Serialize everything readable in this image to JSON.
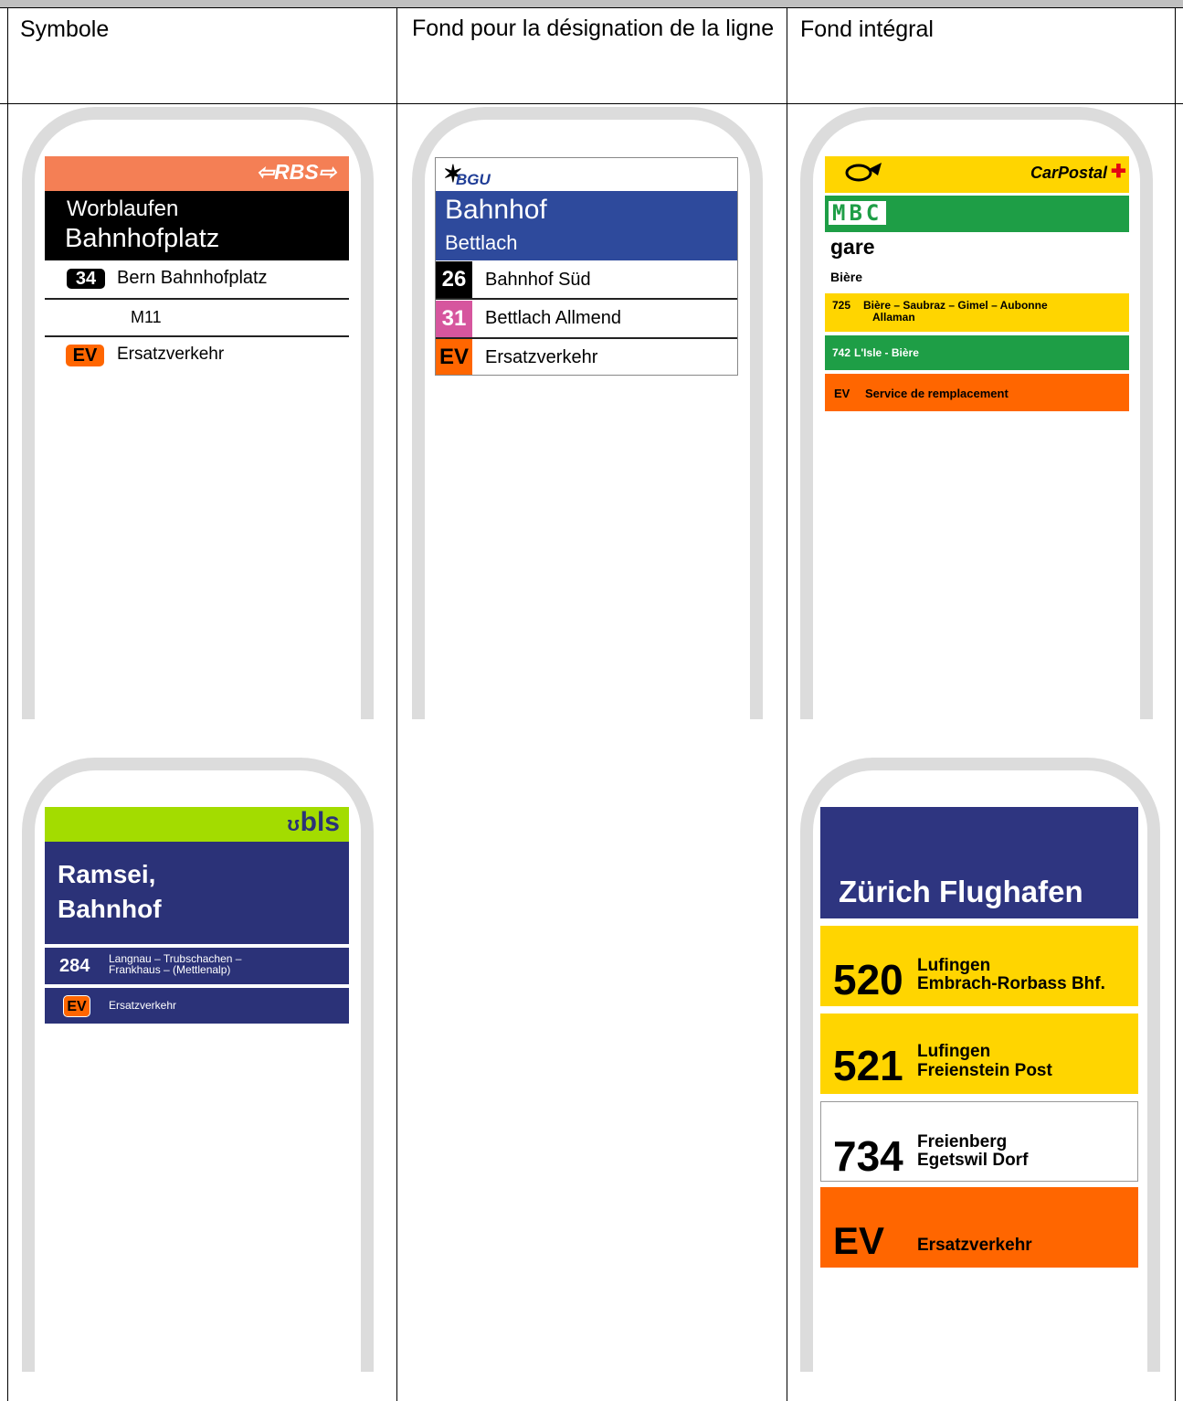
{
  "headers": [
    "Symbole",
    "Fond pour la désignation de la ligne",
    "Fond intégral"
  ],
  "colors": {
    "rbs_orange": "#f47f55",
    "bgu_blue": "#2e4a9c",
    "pink": "#d6569e",
    "ev_orange": "#ff6600",
    "postbus_yellow": "#ffd500",
    "mbc_green": "#1e9e46",
    "bls_green": "#a3dc00",
    "bls_navy": "#2b3278",
    "zvv_navy": "#2e3580"
  },
  "rbs": {
    "logo": "⇦RBS⇨",
    "stop_line1": "Worblaufen",
    "stop_line2": "Bahnhofplatz",
    "rows": [
      {
        "line": "34",
        "dest": "Bern Bahnhofplatz"
      },
      {
        "line": "",
        "dest": "M11"
      },
      {
        "line": "EV",
        "dest": "Ersatzverkehr"
      }
    ]
  },
  "bgu": {
    "logo": "BGU",
    "stop_line1": "Bahnhof",
    "stop_line2": "Bettlach",
    "rows": [
      {
        "line": "26",
        "dest": "Bahnhof Süd"
      },
      {
        "line": "31",
        "dest": "Bettlach Allmend"
      },
      {
        "line": "EV",
        "dest": "Ersatzverkehr"
      }
    ]
  },
  "carpostal": {
    "logo": "CarPostal",
    "mbc_logo": "MBC",
    "stop_line1": "gare",
    "stop_line2": "Bière",
    "rows": [
      {
        "line": "725",
        "dest": "Bière – Saubraz – Gimel – Aubonne",
        "dest2": "Allaman"
      },
      {
        "line": "742",
        "dest": "L'Isle - Bière",
        "dest2": ""
      },
      {
        "line": "EV",
        "dest": "Service de remplacement",
        "dest2": ""
      }
    ]
  },
  "bls": {
    "logo": "bls",
    "stop_line1": "Ramsei,",
    "stop_line2": "Bahnhof",
    "rows": [
      {
        "line": "284",
        "dest": "Langnau – Trubschachen –",
        "dest2": "Frankhaus – (Mettlenalp)"
      },
      {
        "line": "EV",
        "dest": "Ersatzverkehr",
        "dest2": ""
      }
    ]
  },
  "zvv": {
    "stop": "Zürich Flughafen",
    "rows": [
      {
        "line": "520",
        "dest": "Lufingen",
        "dest2": "Embrach-Rorbass Bhf."
      },
      {
        "line": "521",
        "dest": "Lufingen",
        "dest2": "Freienstein Post"
      },
      {
        "line": "734",
        "dest": "Freienberg",
        "dest2": "Egetswil Dorf"
      },
      {
        "line": "EV",
        "dest": "Ersatzverkehr",
        "dest2": ""
      }
    ]
  }
}
